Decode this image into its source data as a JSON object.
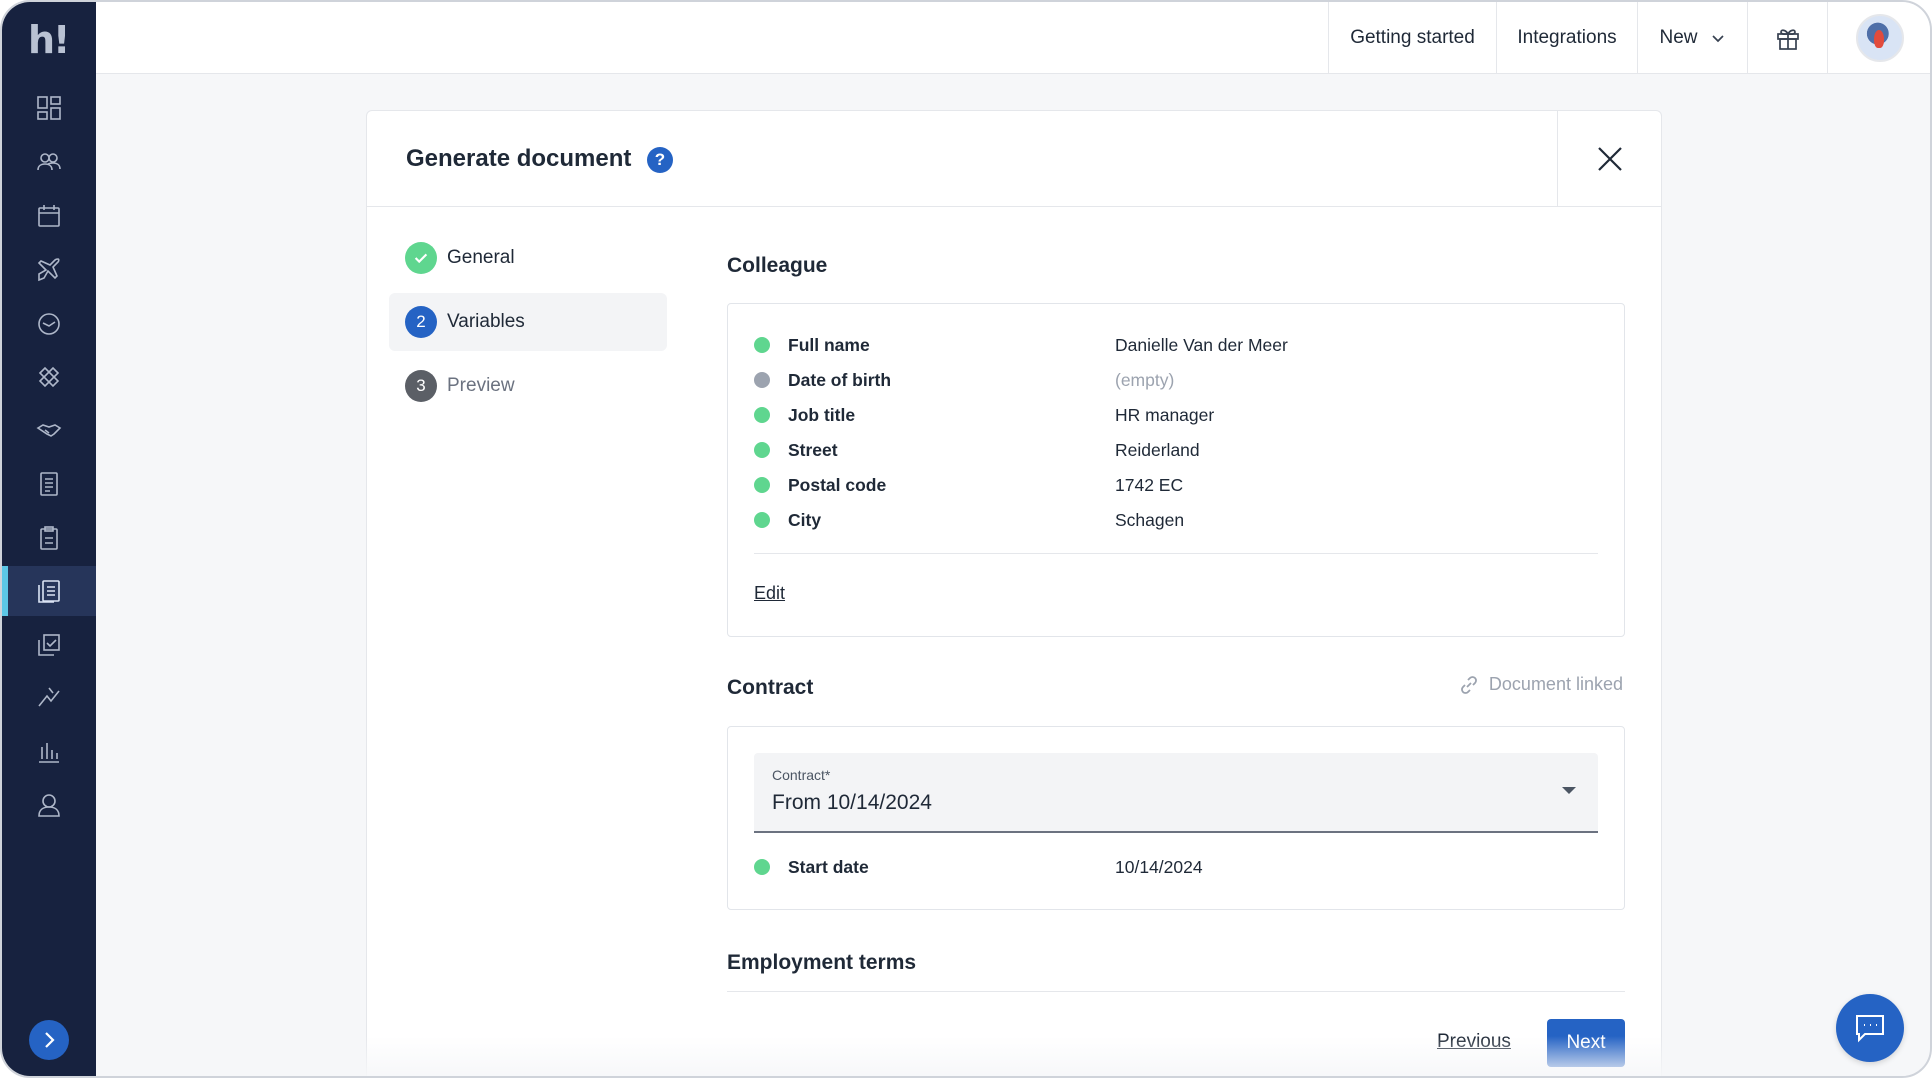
{
  "sidebar": {
    "logo_text": "h!",
    "items": [
      {
        "icon": "dashboard-icon"
      },
      {
        "icon": "people-icon"
      },
      {
        "icon": "calendar-icon"
      },
      {
        "icon": "plane-icon"
      },
      {
        "icon": "clock-icon"
      },
      {
        "icon": "bandage-icon"
      },
      {
        "icon": "handshake-icon"
      },
      {
        "icon": "receipt-icon"
      },
      {
        "icon": "clipboard-icon"
      },
      {
        "icon": "documents-icon",
        "active": true
      },
      {
        "icon": "checklist-icon"
      },
      {
        "icon": "growth-icon"
      },
      {
        "icon": "bar-chart-icon"
      },
      {
        "icon": "user-icon"
      }
    ]
  },
  "topbar": {
    "getting_started": "Getting started",
    "integrations": "Integrations",
    "new_label": "New"
  },
  "modal": {
    "title": "Generate document",
    "help_glyph": "?",
    "steps": [
      {
        "number": "",
        "label": "General",
        "state": "done"
      },
      {
        "number": "2",
        "label": "Variables",
        "state": "current"
      },
      {
        "number": "3",
        "label": "Preview",
        "state": "upcoming"
      }
    ],
    "colleague": {
      "title": "Colleague",
      "rows": [
        {
          "label": "Full name",
          "value": "Danielle Van der Meer",
          "status": "filled"
        },
        {
          "label": "Date of birth",
          "value": "(empty)",
          "status": "empty"
        },
        {
          "label": "Job title",
          "value": "HR manager",
          "status": "filled"
        },
        {
          "label": "Street",
          "value": "Reiderland",
          "status": "filled"
        },
        {
          "label": "Postal code",
          "value": "1742 EC",
          "status": "filled"
        },
        {
          "label": "City",
          "value": "Schagen",
          "status": "filled"
        }
      ],
      "edit_label": "Edit"
    },
    "contract": {
      "title": "Contract",
      "linked_label": "Document linked",
      "select_label": "Contract*",
      "select_value": "From 10/14/2024",
      "rows": [
        {
          "label": "Start date",
          "value": "10/14/2024",
          "status": "filled"
        }
      ]
    },
    "employment_terms": {
      "title": "Employment terms"
    },
    "previous_label": "Previous",
    "next_label": "Next"
  },
  "colors": {
    "primary": "#2563c4",
    "sidebar_bg": "#17223f",
    "status_filled": "#5fd68f",
    "status_empty": "#9ca3af",
    "step_upcoming": "#5b5f66"
  }
}
